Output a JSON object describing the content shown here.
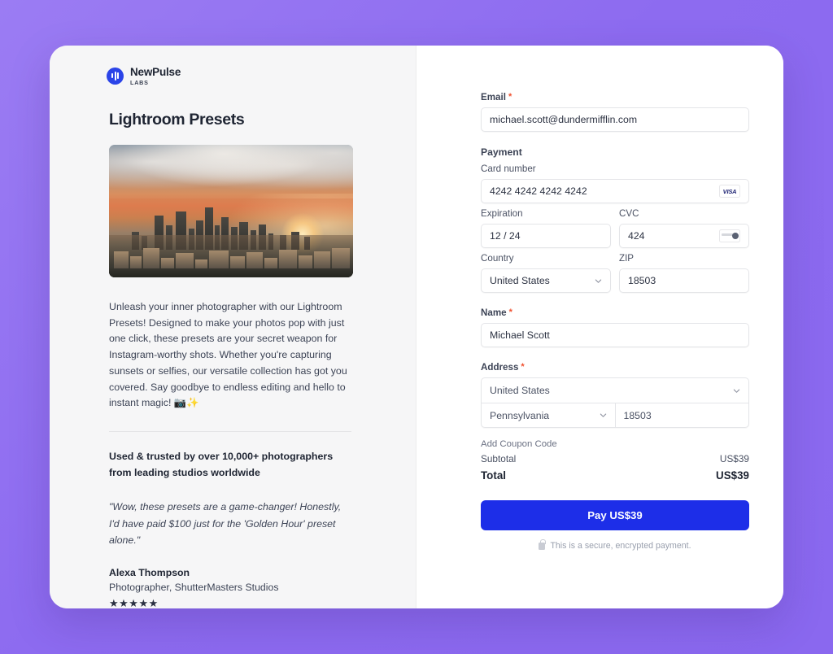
{
  "brand": {
    "name": "NewPulse",
    "sub": "LABS",
    "mark_icon": "pulse-bars-icon",
    "color": "#2b44e8"
  },
  "product": {
    "title": "Lightroom Presets",
    "image_alt": "city-skyline-sunset-photo",
    "description": "Unleash your inner photographer with our Lightroom Presets! Designed to make your photos pop with just one click, these presets are your secret weapon for Instagram-worthy shots. Whether you're capturing sunsets or selfies, our versatile collection has got you covered. Say goodbye to endless editing and hello to instant magic! 📷✨"
  },
  "social_proof": {
    "trust_line": "Used & trusted by over 10,000+ photographers from leading studios worldwide",
    "quote": "\"Wow, these presets are a game-changer! Honestly, I'd have paid $100 just for the 'Golden Hour' preset alone.\"",
    "author_name": "Alexa Thompson",
    "author_role": "Photographer, ShutterMasters Studios",
    "stars": "★★★★★",
    "rating": 5
  },
  "form": {
    "email": {
      "label": "Email",
      "required": "*",
      "value": "michael.scott@dundermifflin.com"
    },
    "payment": {
      "section_label": "Payment",
      "card_number": {
        "label": "Card number",
        "value": "4242 4242 4242 4242",
        "brand_icon": "visa-logo-icon",
        "brand_text": "VISA"
      },
      "expiration": {
        "label": "Expiration",
        "value": "12 / 24"
      },
      "cvc": {
        "label": "CVC",
        "value": "424",
        "icon": "cvc-card-icon"
      },
      "country": {
        "label": "Country",
        "value": "United States",
        "icon": "chevron-down-icon"
      },
      "zip": {
        "label": "ZIP",
        "value": "18503"
      }
    },
    "name": {
      "label": "Name",
      "required": "*",
      "value": "Michael Scott"
    },
    "address": {
      "label": "Address",
      "required": "*",
      "country": "United States",
      "state": "Pennsylvania",
      "zip": "18503",
      "icon": "chevron-down-icon"
    }
  },
  "summary": {
    "coupon_label": "Add Coupon Code",
    "subtotal_label": "Subtotal",
    "subtotal_value": "US$39",
    "total_label": "Total",
    "total_value": "US$39"
  },
  "actions": {
    "pay_label": "Pay US$39",
    "secure_note": "This is a secure, encrypted payment.",
    "lock_icon": "lock-icon",
    "pay_button_color": "#1d2ee8"
  }
}
